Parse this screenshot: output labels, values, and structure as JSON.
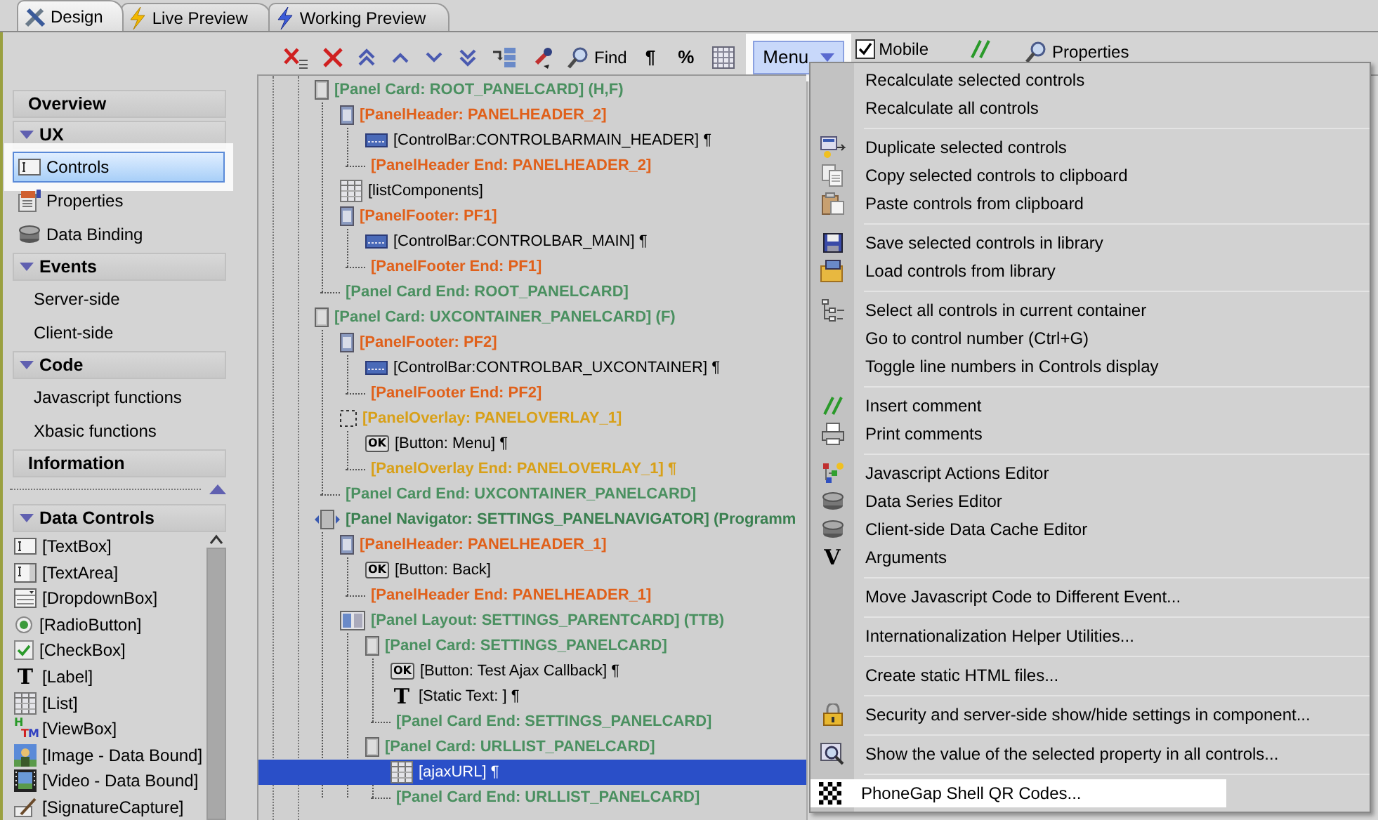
{
  "tabs": [
    {
      "label": "Design",
      "kind": "design",
      "selected": true
    },
    {
      "label": "Live Preview",
      "kind": "live",
      "selected": false
    },
    {
      "label": "Working Preview",
      "kind": "working",
      "selected": false
    }
  ],
  "toolbar": {
    "buttons": [
      {
        "kind": "delete-list"
      },
      {
        "kind": "delete"
      },
      {
        "kind": "top"
      },
      {
        "kind": "up"
      },
      {
        "kind": "down"
      },
      {
        "kind": "bottom"
      },
      {
        "kind": "indent"
      },
      {
        "kind": "picker"
      },
      {
        "kind": "find",
        "label": "Find"
      },
      {
        "kind": "text",
        "label": "¶"
      },
      {
        "kind": "text",
        "label": "%"
      },
      {
        "kind": "grid"
      }
    ],
    "menu_button": {
      "label": "Menu",
      "expanded": true
    },
    "mobile": {
      "label": "Mobile",
      "checked": true
    },
    "properties": {
      "label": "Properties"
    }
  },
  "sidebar": {
    "sections": [
      {
        "title": "Overview",
        "kind": "link"
      },
      {
        "title": "UX",
        "kind": "group",
        "expanded": true,
        "items": [
          {
            "label": "Controls",
            "kind": "textbox",
            "selected": true
          },
          {
            "label": "Properties",
            "kind": "properties",
            "selected": false
          },
          {
            "label": "Data Binding",
            "kind": "database",
            "selected": false
          }
        ]
      },
      {
        "title": "Events",
        "kind": "group",
        "expanded": true,
        "items": [
          {
            "label": "Server-side",
            "kind": "plain",
            "selected": false
          },
          {
            "label": "Client-side",
            "kind": "plain",
            "selected": false
          }
        ]
      },
      {
        "title": "Code",
        "kind": "group",
        "expanded": true,
        "items": [
          {
            "label": "Javascript functions",
            "kind": "plain",
            "selected": false
          },
          {
            "label": "Xbasic functions",
            "kind": "plain",
            "selected": false
          }
        ]
      },
      {
        "title": "Information",
        "kind": "link"
      }
    ],
    "data_controls": {
      "title": "Data Controls",
      "expanded": true,
      "items": [
        {
          "label": "[TextBox]",
          "kind": "textbox"
        },
        {
          "label": "[TextArea]",
          "kind": "textarea"
        },
        {
          "label": "[DropdownBox]",
          "kind": "dropdown"
        },
        {
          "label": "[RadioButton]",
          "kind": "radio"
        },
        {
          "label": "[CheckBox]",
          "kind": "checkbox"
        },
        {
          "label": "[Label]",
          "kind": "glyph",
          "icon_text": "T"
        },
        {
          "label": "[List]",
          "kind": "list"
        },
        {
          "label": "[ViewBox]",
          "kind": "htm",
          "icon_text": "HTM"
        },
        {
          "label": "[Image - Data Bound]",
          "kind": "image"
        },
        {
          "label": "[Video - Data Bound]",
          "kind": "video"
        },
        {
          "label": "[SignatureCapture]",
          "kind": "signature"
        }
      ]
    }
  },
  "tree": [
    {
      "label": "[Panel Card: ROOT_PANELCARD]  (H,F)",
      "kind": "card",
      "selected": false,
      "children": [
        {
          "label": "[PanelHeader: PANELHEADER_2]",
          "kind": "header",
          "selected": false,
          "children": [
            {
              "label": "[ControlBar:CONTROLBARMAIN_HEADER] ¶",
              "kind": "controlbar",
              "selected": false
            },
            {
              "label": "[PanelHeader End: PANELHEADER_2]",
              "kind": "header-end",
              "selected": false
            }
          ]
        },
        {
          "label": "[listComponents]",
          "kind": "list",
          "selected": false
        },
        {
          "label": "[PanelFooter: PF1]",
          "kind": "header",
          "selected": false,
          "children": [
            {
              "label": "[ControlBar:CONTROLBAR_MAIN] ¶",
              "kind": "controlbar",
              "selected": false
            },
            {
              "label": "[PanelFooter End: PF1]",
              "kind": "header-end",
              "selected": false
            }
          ]
        },
        {
          "label": "[Panel Card End: ROOT_PANELCARD]",
          "kind": "card-end",
          "selected": false
        }
      ]
    },
    {
      "label": "[Panel Card: UXCONTAINER_PANELCARD]  (F)",
      "kind": "card",
      "selected": false,
      "children": [
        {
          "label": "[PanelFooter: PF2]",
          "kind": "header",
          "selected": false,
          "children": [
            {
              "label": "[ControlBar:CONTROLBAR_UXCONTAINER] ¶",
              "kind": "controlbar",
              "selected": false
            },
            {
              "label": "[PanelFooter End: PF2]",
              "kind": "header-end",
              "selected": false
            }
          ]
        },
        {
          "label": "[PanelOverlay: PANELOVERLAY_1]",
          "kind": "overlay",
          "selected": false,
          "children": [
            {
              "label": "[Button: Menu] ¶",
              "kind": "button",
              "icon_text": "OK",
              "selected": false
            },
            {
              "label": "[PanelOverlay End: PANELOVERLAY_1] ¶",
              "kind": "overlay-end",
              "selected": false
            }
          ]
        },
        {
          "label": "[Panel Card End: UXCONTAINER_PANELCARD]",
          "kind": "card-end",
          "selected": false
        }
      ]
    },
    {
      "label": "[Panel Navigator: SETTINGS_PANELNAVIGATOR] (Programm",
      "kind": "navigator",
      "selected": false,
      "children": [
        {
          "label": "[PanelHeader: PANELHEADER_1]",
          "kind": "header",
          "selected": false,
          "children": [
            {
              "label": "[Button: Back]",
              "kind": "button",
              "icon_text": "OK",
              "selected": false
            },
            {
              "label": "[PanelHeader End: PANELHEADER_1]",
              "kind": "header-end",
              "selected": false
            }
          ]
        },
        {
          "label": "[Panel Layout: SETTINGS_PARENTCARD] (TTB)",
          "kind": "layout",
          "selected": false,
          "children": [
            {
              "label": "[Panel Card: SETTINGS_PANELCARD]",
              "kind": "card",
              "selected": false,
              "children": [
                {
                  "label": "[Button: Test Ajax Callback] ¶",
                  "kind": "button",
                  "icon_text": "OK",
                  "selected": false
                },
                {
                  "label": "[Static Text: ] ¶",
                  "kind": "glyph",
                  "icon_text": "T",
                  "selected": false
                },
                {
                  "label": "[Panel Card End: SETTINGS_PANELCARD]",
                  "kind": "card-end",
                  "selected": false
                }
              ]
            },
            {
              "label": "[Panel Card: URLLIST_PANELCARD]",
              "kind": "card",
              "selected": false,
              "children": [
                {
                  "label": "[ajaxURL] ¶",
                  "kind": "list",
                  "selected": true
                },
                {
                  "label": "[Panel Card End: URLLIST_PANELCARD]",
                  "kind": "card-end",
                  "selected": false
                }
              ]
            }
          ]
        }
      ]
    }
  ],
  "menu": {
    "groups": [
      {
        "items": [
          {
            "label": "Recalculate selected controls",
            "kind": "none",
            "selected": false
          },
          {
            "label": "Recalculate all controls",
            "kind": "none",
            "selected": false
          }
        ]
      },
      {
        "items": [
          {
            "label": "Duplicate selected controls",
            "kind": "duplicate",
            "selected": false
          },
          {
            "label": "Copy selected controls to clipboard",
            "kind": "copy",
            "selected": false
          },
          {
            "label": "Paste controls from clipboard",
            "kind": "paste",
            "selected": false
          }
        ]
      },
      {
        "items": [
          {
            "label": "Save selected controls in library",
            "kind": "save",
            "selected": false
          },
          {
            "label": "Load controls from library",
            "kind": "load",
            "selected": false
          }
        ]
      },
      {
        "items": [
          {
            "label": "Select all controls in current container",
            "kind": "select",
            "selected": false
          },
          {
            "label": "Go to control number (Ctrl+G)",
            "kind": "none",
            "selected": false
          },
          {
            "label": "Toggle line numbers in Controls display",
            "kind": "none",
            "selected": false
          }
        ]
      },
      {
        "items": [
          {
            "label": "Insert comment",
            "kind": "comment",
            "selected": false
          },
          {
            "label": "Print comments",
            "kind": "print",
            "selected": false
          }
        ]
      },
      {
        "items": [
          {
            "label": "Javascript Actions Editor",
            "kind": "actions",
            "selected": false
          },
          {
            "label": "Data Series Editor",
            "kind": "database",
            "selected": false
          },
          {
            "label": "Client-side Data Cache Editor",
            "kind": "database",
            "selected": false
          },
          {
            "label": "Arguments",
            "kind": "glyph",
            "icon_text": "V",
            "selected": false
          }
        ]
      },
      {
        "items": [
          {
            "label": "Move Javascript Code to Different Event...",
            "kind": "none",
            "selected": false
          }
        ]
      },
      {
        "items": [
          {
            "label": "Internationalization Helper Utilities...",
            "kind": "none",
            "selected": false
          }
        ]
      },
      {
        "items": [
          {
            "label": "Create static HTML files...",
            "kind": "none",
            "selected": false
          }
        ]
      },
      {
        "items": [
          {
            "label": "Security and server-side show/hide settings in component...",
            "kind": "lock",
            "selected": false
          }
        ]
      },
      {
        "items": [
          {
            "label": "Show the value of the selected property in all controls...",
            "kind": "inspect",
            "selected": false
          }
        ]
      },
      {
        "items": [
          {
            "label": "PhoneGap Shell QR Codes...",
            "kind": "qr",
            "selected": true
          }
        ]
      }
    ]
  }
}
